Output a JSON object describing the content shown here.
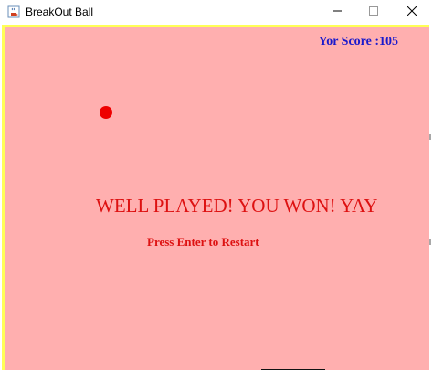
{
  "window": {
    "title": "BreakOut Ball"
  },
  "icons": {
    "app": "java-coffee-cup-icon",
    "minimize": "minimize-icon",
    "maximize": "maximize-icon",
    "close": "close-icon"
  },
  "game": {
    "score_text": "Yor Score :105",
    "win_message": "WELL PLAYED! YOU WON! YAY",
    "restart_message": "Press Enter to Restart"
  },
  "colors": {
    "background": "#ffafaf",
    "border": "#ffff55",
    "score": "#1a1acc",
    "message": "#dd1111",
    "ball": "#ee0000",
    "paddle": "#111111"
  }
}
